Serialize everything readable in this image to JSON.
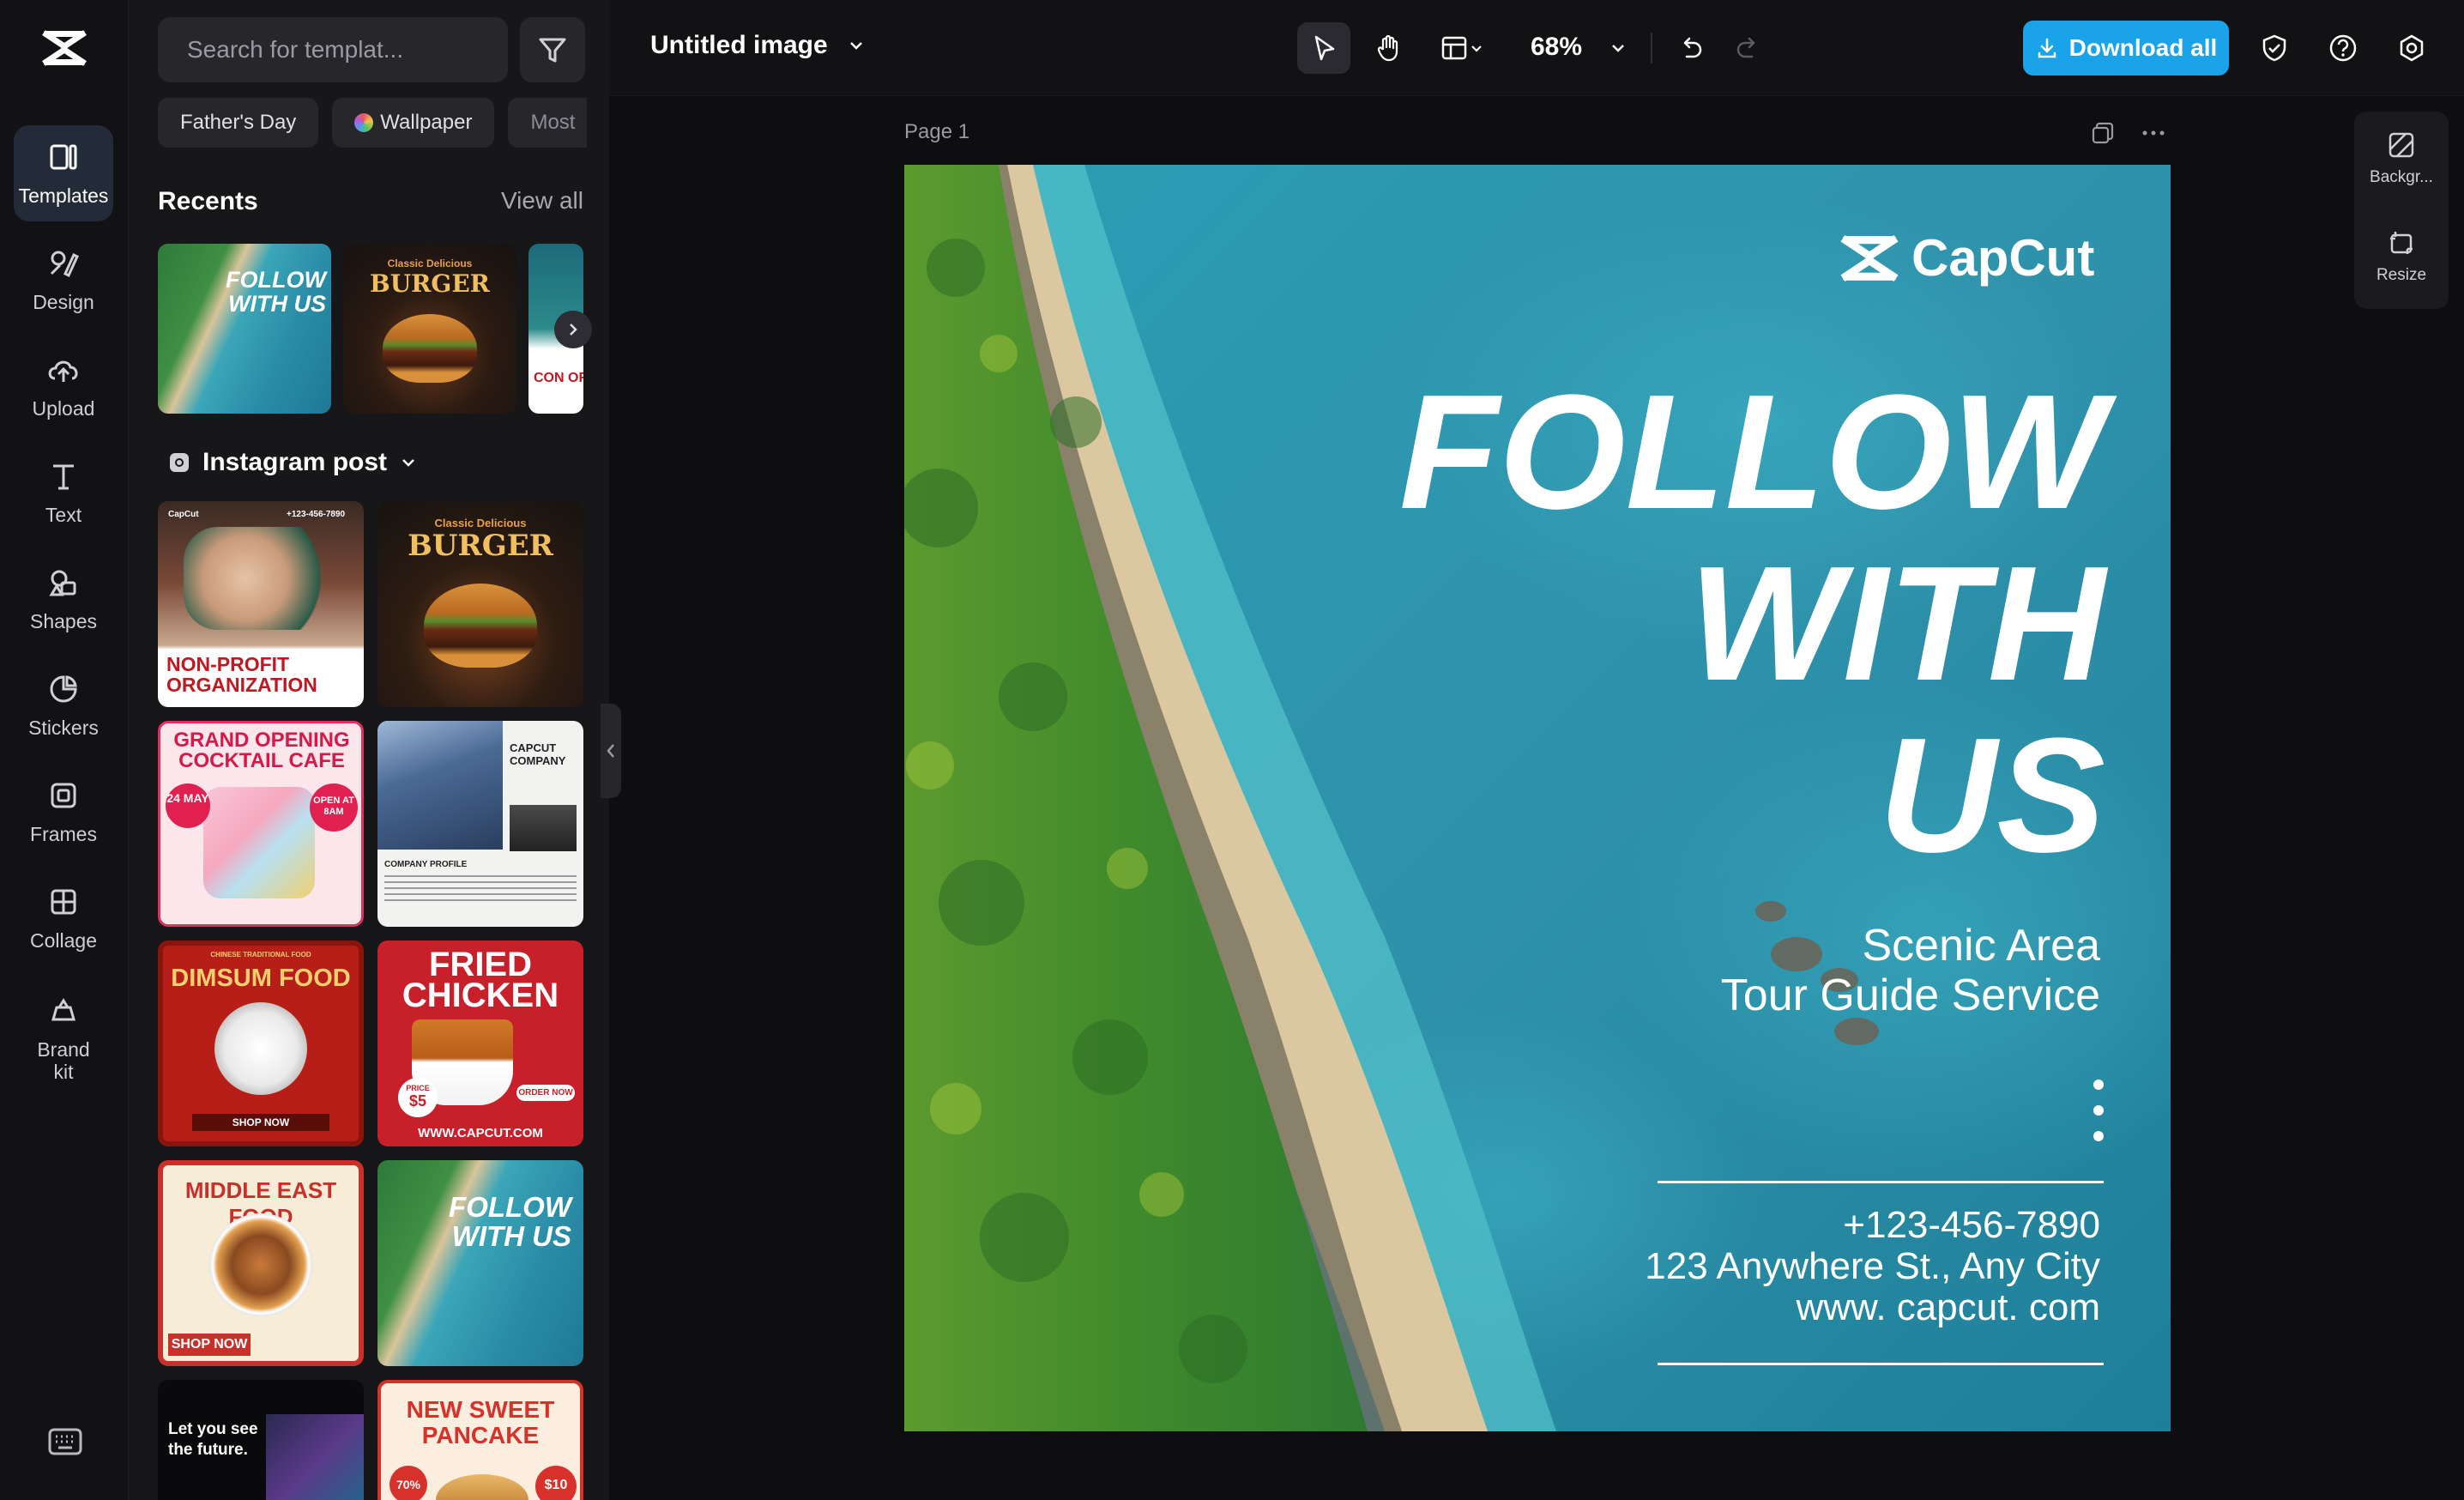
{
  "app": {
    "name": "CapCut"
  },
  "rail": {
    "items": [
      {
        "label": "Templates",
        "icon": "templates-icon",
        "active": true
      },
      {
        "label": "Design",
        "icon": "design-icon"
      },
      {
        "label": "Upload",
        "icon": "upload-icon"
      },
      {
        "label": "Text",
        "icon": "text-icon"
      },
      {
        "label": "Shapes",
        "icon": "shapes-icon"
      },
      {
        "label": "Stickers",
        "icon": "stickers-icon"
      },
      {
        "label": "Frames",
        "icon": "frames-icon"
      },
      {
        "label": "Collage",
        "icon": "collage-icon"
      },
      {
        "label": "Brand kit",
        "icon": "brand-kit-icon"
      }
    ]
  },
  "panel": {
    "search_placeholder": "Search for templat...",
    "chips": [
      "Father's Day",
      "Wallpaper",
      "Most"
    ],
    "recents_title": "Recents",
    "view_all": "View all",
    "recents": [
      {
        "title": "FOLLOW WITH US"
      },
      {
        "title": "BURGER",
        "subtitle": "Classic Delicious"
      },
      {
        "title": "CON ORGA"
      }
    ],
    "category": "Instagram post",
    "templates": [
      {
        "title": "NON-PROFIT ORGANIZATION",
        "phone": "+123-456-7890",
        "brand": "CapCut"
      },
      {
        "title": "BURGER",
        "subtitle": "Classic Delicious"
      },
      {
        "title": "GRAND OPENING COCKTAIL CAFE",
        "badge1": "24 MAY",
        "badge2": "OPEN AT 8AM"
      },
      {
        "title": "COMPANY PROFILE",
        "heading": "CAPCUT COMPANY"
      },
      {
        "title": "DIMSUM FOOD",
        "tag": "CHINESE TRADITIONAL FOOD",
        "cta": "SHOP NOW"
      },
      {
        "title": "FRIED CHICKEN",
        "price": "$5",
        "price_label": "PRICE",
        "cta": "ORDER NOW",
        "url": "WWW.CAPCUT.COM"
      },
      {
        "title": "MIDDLE EAST FOOD",
        "cta": "SHOP NOW"
      },
      {
        "title": "FOLLOW WITH US"
      },
      {
        "title": "Let you see the future."
      },
      {
        "title": "NEW SWEET PANCAKE",
        "discount": "70%",
        "price": "$10"
      }
    ]
  },
  "topbar": {
    "doc_title": "Untitled image",
    "zoom": "68%",
    "download_label": "Download all"
  },
  "canvas": {
    "page_label": "Page 1",
    "side_tools": [
      "Backgr...",
      "Resize"
    ]
  },
  "design": {
    "brand": "CapCut",
    "headline": [
      "FOLLOW",
      "WITH",
      "US"
    ],
    "sub1": "Scenic Area",
    "sub2": "Tour Guide Service",
    "phone": "+123-456-7890",
    "address": "123 Anywhere St., Any City",
    "website": "www. capcut. com"
  },
  "colors": {
    "accent": "#1aa3e8",
    "panel_bg": "#17171a",
    "rail_active": "#232a38"
  }
}
